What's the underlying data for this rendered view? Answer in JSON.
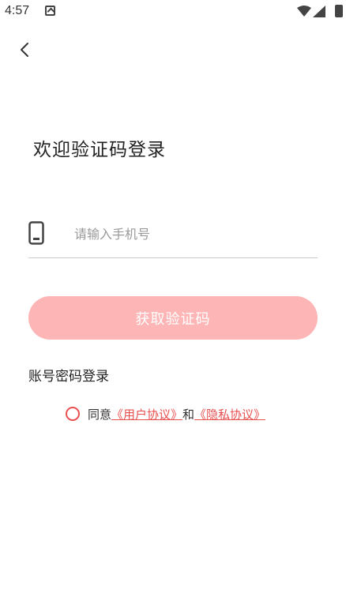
{
  "status_bar": {
    "time": "4:57"
  },
  "page": {
    "title": "欢迎验证码登录"
  },
  "phone": {
    "placeholder": "请输入手机号",
    "value": ""
  },
  "get_code_button": {
    "label": "获取验证码"
  },
  "password_login": {
    "label": "账号密码登录"
  },
  "agreement": {
    "prefix": "同意",
    "user_agreement": "《用户协议》",
    "conjunction": "和",
    "privacy_policy": "《隐私协议》",
    "checked": false
  },
  "colors": {
    "accent": "#e85050",
    "button_bg": "#fdb5b5",
    "button_text": "#ffffff"
  }
}
